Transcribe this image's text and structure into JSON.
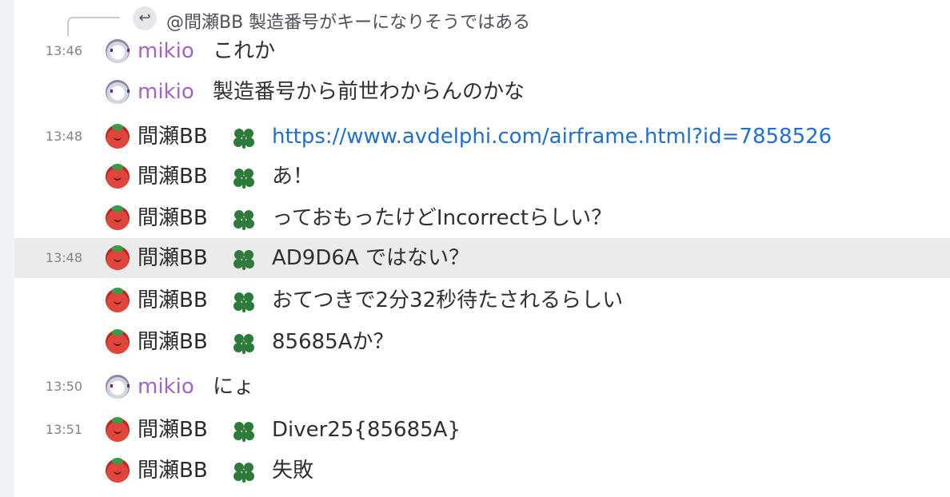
{
  "reply": {
    "icon": "reply-arrow-icon",
    "text": "@間瀬BB 製造番号がキーになりそうではある"
  },
  "messages": [
    {
      "time": "13:46",
      "author": "mikio",
      "avatar": "mikio-avatar",
      "text": "これか"
    },
    {
      "time": "",
      "author": "mikio",
      "avatar": "mikio-avatar",
      "text": "製造番号から前世わからんのかな"
    },
    {
      "time": "13:48",
      "author": "間瀬BB",
      "avatar": "tomato-avatar",
      "role_icon": "clover-icon",
      "text": "https://www.avdelphi.com/airframe.html?id=7858526",
      "is_link": true
    },
    {
      "time": "",
      "author": "間瀬BB",
      "avatar": "tomato-avatar",
      "role_icon": "clover-icon",
      "text": "あ！"
    },
    {
      "time": "",
      "author": "間瀬BB",
      "avatar": "tomato-avatar",
      "role_icon": "clover-icon",
      "text": "っておもったけどIncorrectらしい？"
    },
    {
      "time": "13:48",
      "author": "間瀬BB",
      "avatar": "tomato-avatar",
      "role_icon": "clover-icon",
      "text": "AD9D6A ではない？",
      "highlighted": true
    },
    {
      "time": "",
      "author": "間瀬BB",
      "avatar": "tomato-avatar",
      "role_icon": "clover-icon",
      "text": "おてつきで2分32秒待たされるらしい"
    },
    {
      "time": "",
      "author": "間瀬BB",
      "avatar": "tomato-avatar",
      "role_icon": "clover-icon",
      "text": "85685Aか？"
    },
    {
      "time": "13:50",
      "author": "mikio",
      "avatar": "mikio-avatar",
      "text": "にょ"
    },
    {
      "time": "13:51",
      "author": "間瀬BB",
      "avatar": "tomato-avatar",
      "role_icon": "clover-icon",
      "text": "Diver25{85685A}"
    },
    {
      "time": "",
      "author": "間瀬BB",
      "avatar": "tomato-avatar",
      "role_icon": "clover-icon",
      "text": "失敗"
    }
  ],
  "colors": {
    "mikio_name": "#a463c9",
    "bb_name": "#2a2b2f",
    "link": "#1f6fd1",
    "highlight_row": "#ebebeb",
    "clover": "#2d7a3a"
  }
}
